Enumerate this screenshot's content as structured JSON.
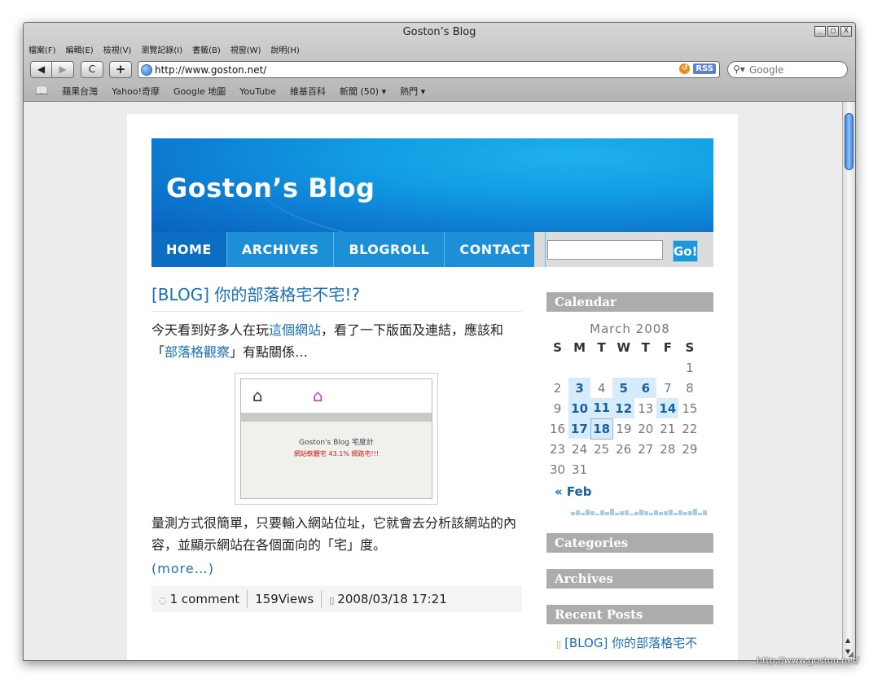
{
  "browser": {
    "window_title": "Goston’s Blog",
    "menu": [
      "檔案(F)",
      "編輯(E)",
      "檢視(V)",
      "瀏覽記錄(I)",
      "書籤(B)",
      "視窗(W)",
      "說明(H)"
    ],
    "nav": {
      "back": "◀",
      "forward": "▶",
      "reload": "C",
      "add": "+"
    },
    "url": "http://www.goston.net/",
    "rss_label": "RSS",
    "search_placeholder": "Google",
    "bookmarks": [
      "蘋果台灣",
      "Yahoo!奇摩",
      "Google 地圖",
      "YouTube",
      "維基百科",
      "新聞 (50) ▾",
      "熱門 ▾"
    ],
    "window_buttons": [
      "_",
      "□",
      "X"
    ]
  },
  "blog": {
    "title": "Goston’s Blog",
    "nav": [
      "HOME",
      "ARCHIVES",
      "BLOGROLL",
      "CONTACT"
    ],
    "go_label": "Go!",
    "post": {
      "title": "[BLOG] 你的部落格宅不宅!?",
      "para1_before": "今天看到好多人在玩",
      "para1_link": "這個網站",
      "para1_after": "，看了一下版面及連結，應該和「",
      "para1_link2": "部落格觀察",
      "para1_end": "」有點關係…",
      "image_heading": "Goston's Blog 宅度計",
      "image_red": "網站軟體宅 43.1% 網路宅!!!",
      "para2": "量測方式很簡單，只要輸入網站位址，它就會去分析該網站的內容，並顯示網站在各個面向的「宅」度。",
      "more": "(more…)",
      "comments": "1 comment",
      "views": "159Views",
      "date": "2008/03/18 17:21"
    },
    "sidebar": {
      "calendar_title": "Calendar",
      "month": "March 2008",
      "weekdays": [
        "S",
        "M",
        "T",
        "W",
        "T",
        "F",
        "S"
      ],
      "weeks": [
        [
          "",
          "",
          "",
          "",
          "",
          "",
          "1"
        ],
        [
          "2",
          "3",
          "4",
          "5",
          "6",
          "7",
          "8"
        ],
        [
          "9",
          "10",
          "11",
          "12",
          "13",
          "14",
          "15"
        ],
        [
          "16",
          "17",
          "18",
          "19",
          "20",
          "21",
          "22"
        ],
        [
          "23",
          "24",
          "25",
          "26",
          "27",
          "28",
          "29"
        ],
        [
          "30",
          "31",
          "",
          "",
          "",
          "",
          ""
        ]
      ],
      "linked_days": [
        "3",
        "5",
        "6",
        "10",
        "11",
        "12",
        "14",
        "17",
        "18"
      ],
      "today": "18",
      "prev_month": "« Feb",
      "categories_title": "Categories",
      "archives_title": "Archives",
      "recent_title": "Recent Posts",
      "recent_post": "[BLOG] 你的部落格宅不"
    }
  },
  "watermark": "http://www.goston.net/",
  "colors": {
    "accent": "#1d8fd6",
    "link": "#1a6fb4",
    "widget_header": "#acacac"
  }
}
